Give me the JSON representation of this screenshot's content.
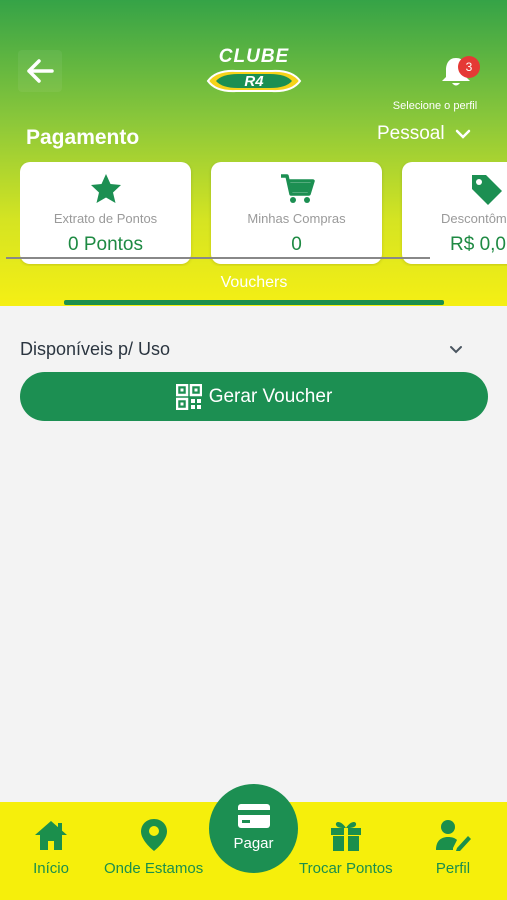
{
  "header": {
    "logo_text": "CLUBE R4",
    "notification_count": "3",
    "profile_hint": "Selecione o perfil",
    "title": "Pagamento",
    "profile_value": "Pessoal"
  },
  "cards": [
    {
      "icon": "star-icon",
      "label": "Extrato de Pontos",
      "value": "0 Pontos"
    },
    {
      "icon": "cart-icon",
      "label": "Minhas Compras",
      "value": "0"
    },
    {
      "icon": "tag-icon",
      "label": "Descontôm",
      "value": "R$ 0,0"
    }
  ],
  "tabs": {
    "active": "Vouchers"
  },
  "section": {
    "title": "Disponíveis p/ Uso"
  },
  "generate_button": {
    "label": "Gerar Voucher",
    "icon": "qr-code-icon"
  },
  "bottom_nav": {
    "items": [
      {
        "label": "Início",
        "icon": "home-icon"
      },
      {
        "label": "Onde Estamos",
        "icon": "map-pin-icon"
      },
      {
        "label": "Trocar Pontos",
        "icon": "gift-icon"
      },
      {
        "label": "Perfil",
        "icon": "user-edit-icon"
      }
    ],
    "pay": {
      "label": "Pagar",
      "icon": "credit-card-icon"
    }
  },
  "colors": {
    "brand_green": "#1c8f52",
    "header_top": "#35a347",
    "header_bottom": "#f5ef14",
    "nav_yellow": "#f6ef0b",
    "badge_red": "#e53935"
  }
}
